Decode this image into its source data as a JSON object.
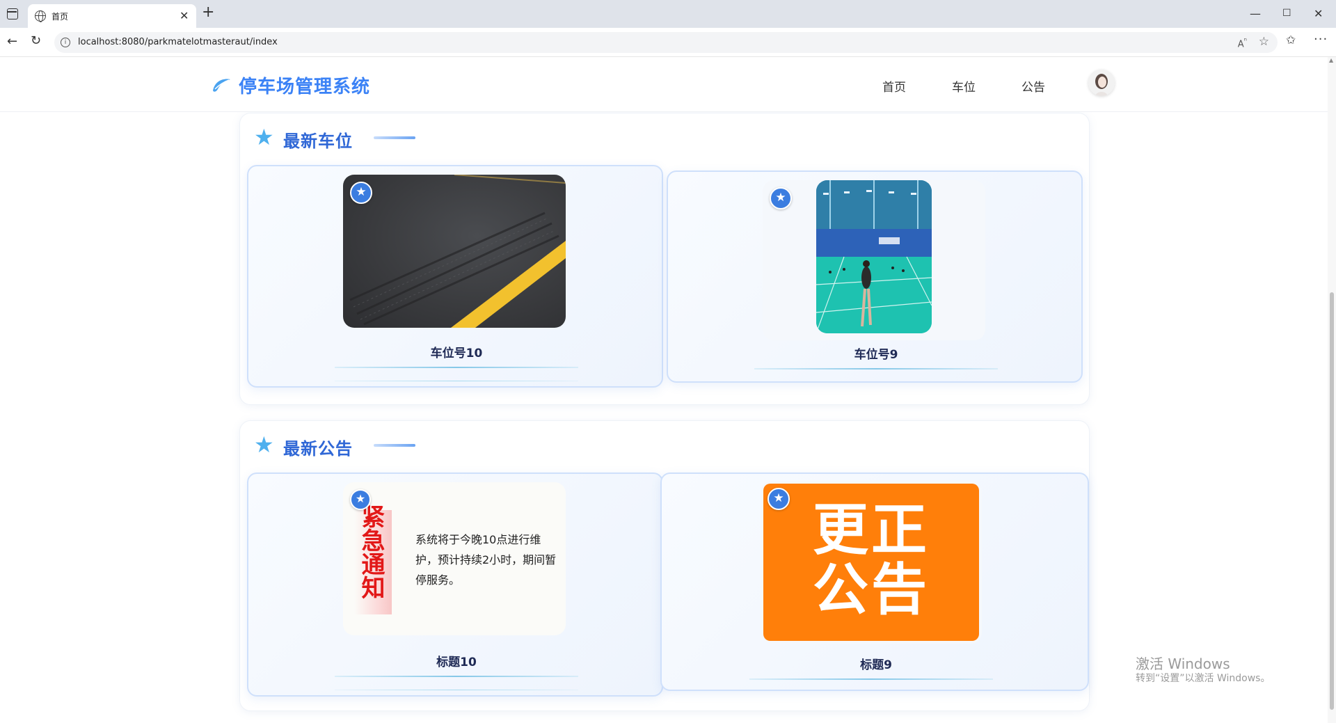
{
  "browser": {
    "tab_title": "首页",
    "url": "localhost:8080/parkmatelotmasteraut/index"
  },
  "header": {
    "brand": "停车场管理系统",
    "nav": [
      "首页",
      "车位",
      "公告"
    ]
  },
  "sections": [
    {
      "title": "最新车位",
      "cards": [
        {
          "label": "车位号10"
        },
        {
          "label": "车位号9"
        }
      ]
    },
    {
      "title": "最新公告",
      "cards": [
        {
          "label": "标题10",
          "image_text": {
            "vertical": "紧急通知",
            "body": "系统将于今晚10点进行维护，预计持续2小时，期间暂停服务。"
          }
        },
        {
          "label": "标题9",
          "image_text": {
            "line1": "更正",
            "line2": "公告"
          }
        }
      ]
    }
  ],
  "watermark": {
    "line1": "激活 Windows",
    "line2": "转到“设置”以激活 Windows。"
  },
  "colors": {
    "brand_blue": "#3b82f6",
    "section_title": "#2f67d6",
    "star": "#4fb0ee",
    "orange": "#ff7f0a"
  }
}
